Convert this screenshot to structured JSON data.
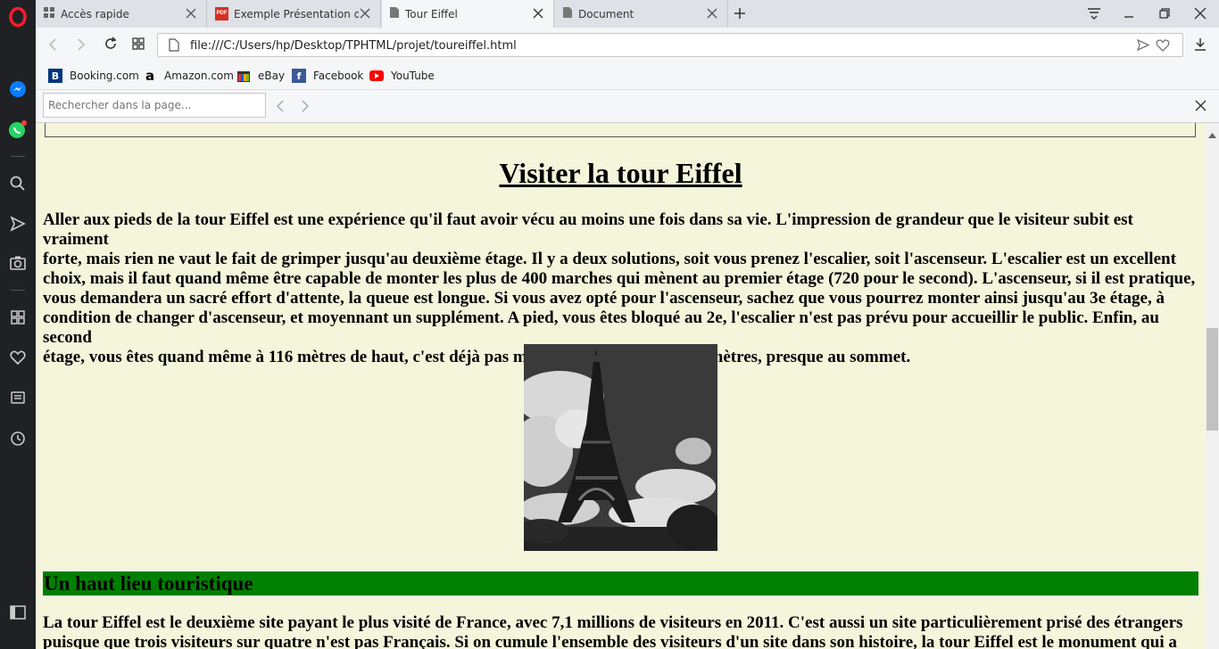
{
  "browser": {
    "tabs": [
      {
        "label": "Accès rapide",
        "icon": "grid-icon"
      },
      {
        "label": "Exemple Présentation du p",
        "icon": "pdf-icon"
      },
      {
        "label": "Tour Eiffel",
        "icon": "page-icon",
        "active": true
      },
      {
        "label": "Document",
        "icon": "page-icon"
      }
    ],
    "url": "file:///C:/Users/hp/Desktop/TPHTML/projet/toureiffel.html",
    "bookmarks": [
      {
        "label": "Booking.com",
        "icon": "B",
        "color": "#003580"
      },
      {
        "label": "Amazon.com",
        "icon": "a",
        "color": "#000000"
      },
      {
        "label": "eBay",
        "icon": "ebay-icon",
        "color": "#e53238"
      },
      {
        "label": "Facebook",
        "icon": "f",
        "color": "#3b5998"
      },
      {
        "label": "YouTube",
        "icon": "youtube-icon",
        "color": "#ff0000"
      }
    ],
    "find": {
      "placeholder": "Rechercher dans la page..."
    },
    "accent": "#ff1b2d"
  },
  "page": {
    "title": "Visiter la tour Eiffel",
    "intro_lines": [
      "Aller aux pieds de la tour Eiffel est une expérience qu'il faut avoir vécu au moins une fois dans sa vie. L'impression de grandeur que le visiteur subit est vraiment",
      "forte, mais rien ne vaut le fait de grimper jusqu'au deuxième étage. Il y a deux solutions, soit vous prenez l'escalier, soit l'ascenseur. L'escalier est un excellent",
      "choix, mais il faut quand même être capable de monter les plus de 400 marches qui mènent au premier étage (720 pour le second). L'ascenseur, si il est pratique,",
      "vous demandera un sacré effort d'attente, la queue est longue. Si vous avez opté pour l'ascenseur, sachez que vous pourrez monter ainsi jusqu'au 3e étage, à",
      "condition de changer d'ascenseur, et moyennant un supplément. A pied, vous êtes bloqué au 2e, l'escalier n'est pas prévu pour accueillir le public. Enfin, au second",
      "étage, vous êtes quand même à 116 mètres de haut, c'est déjà pas mal. Le troisième est à 276 mètres, presque au sommet."
    ],
    "section_title": "Un haut lieu touristique",
    "section_lines": [
      "La tour Eiffel est le deuxième site payant le plus visité de France, avec 7,1 millions de visiteurs en 2011. C'est aussi un site particulièrement prisé des étrangers",
      "puisque que trois visiteurs sur quatre n'est pas Français. Si on cumule l'ensemble des visiteurs d'un site dans son histoire, la tour Eiffel est le monument qui a été"
    ],
    "background": "#f5f5dc",
    "section_color": "#008000"
  }
}
